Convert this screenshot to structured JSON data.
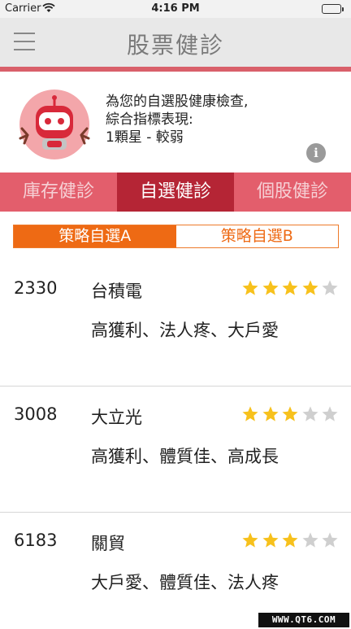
{
  "status_bar": {
    "carrier": "Carrier",
    "wifi_icon": "wifi-icon",
    "time": "4:16 PM",
    "battery_icon": "battery-icon",
    "battery_level": 1.0
  },
  "navbar": {
    "menu_icon": "hamburger-menu-icon",
    "title": "股票健診"
  },
  "info": {
    "mascot_icon": "robot-mascot-icon",
    "line1": "為您的自選股健康檢查,",
    "line2": "綜合指標表現:",
    "line3": "1顆星 - 較弱",
    "info_button": "i"
  },
  "tabs": [
    {
      "label": "庫存健診",
      "active": false
    },
    {
      "label": "自選健診",
      "active": true
    },
    {
      "label": "個股健診",
      "active": false
    }
  ],
  "segments": [
    {
      "label": "策略自選A",
      "active": true
    },
    {
      "label": "策略自選B",
      "active": false
    }
  ],
  "stocks": [
    {
      "code": "2330",
      "name": "台積電",
      "tags": "高獲利、法人疼、大戶愛",
      "rating": 4,
      "max_rating": 5
    },
    {
      "code": "3008",
      "name": "大立光",
      "tags": "高獲利、體質佳、高成長",
      "rating": 3,
      "max_rating": 5
    },
    {
      "code": "6183",
      "name": "關貿",
      "tags": "大戶愛、體質佳、法人疼",
      "rating": 3,
      "max_rating": 5
    }
  ],
  "watermark": "WWW.QT6.COM",
  "colors": {
    "accent_red": "#e35e6c",
    "active_tab": "#b52535",
    "segment_orange": "#ee6a14",
    "star_filled": "#f7c11c",
    "star_empty": "#cfcfcf"
  }
}
